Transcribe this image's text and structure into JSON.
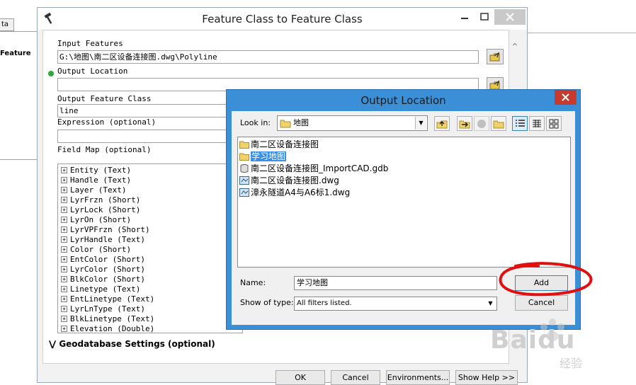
{
  "background": {
    "tab_text": "ta",
    "side_text": "Feature"
  },
  "main_dialog": {
    "title": "Feature Class to Feature Class",
    "input_features_label": "Input Features",
    "input_features_value": "G:\\地图\\南二区设备连接图.dwg\\Polyline",
    "output_location_label": "Output Location",
    "output_location_value": "",
    "output_feature_class_label": "Output Feature Class",
    "output_feature_class_value": "line",
    "expression_label": "Expression (optional)",
    "expression_value": "",
    "field_map_label": "Field Map (optional)",
    "fields": [
      "Entity (Text)",
      "Handle (Text)",
      "Layer (Text)",
      "LyrFrzn (Short)",
      "LyrLock (Short)",
      "LyrOn (Short)",
      "LyrVPFrzn (Short)",
      "LyrHandle (Text)",
      "Color (Short)",
      "EntColor (Short)",
      "LyrColor (Short)",
      "BlkColor (Short)",
      "Linetype (Text)",
      "EntLinetype (Text)",
      "LyrLnType (Text)",
      "BlkLinetype (Text)",
      "Elevation (Double)"
    ],
    "geodatabase_settings": "Geodatabase Settings (optional)",
    "buttons": {
      "ok": "OK",
      "cancel": "Cancel",
      "environments": "Environments...",
      "show_help": "Show Help >>"
    }
  },
  "output_dialog": {
    "title": "Output Location",
    "look_in_label": "Look in:",
    "look_in_value": "地图",
    "files": [
      {
        "name": "南二区设备连接图",
        "icon": "folder-icon",
        "selected": false
      },
      {
        "name": "学习地图",
        "icon": "folder-icon",
        "selected": true
      },
      {
        "name": "南二区设备连接图_ImportCAD.gdb",
        "icon": "geodatabase-icon",
        "selected": false
      },
      {
        "name": "南二区设备连接图.dwg",
        "icon": "cad-drawing-icon",
        "selected": false
      },
      {
        "name": "漳永隧道A4与A6标1.dwg",
        "icon": "cad-drawing-icon",
        "selected": false
      }
    ],
    "name_label": "Name:",
    "name_value": "学习地图",
    "show_type_label": "Show of type:",
    "show_type_value": "All filters listed.",
    "add_button": "Add",
    "cancel_button": "Cancel"
  },
  "watermark": {
    "text": "Baidu",
    "sub": "经验"
  },
  "colors": {
    "output_dialog_frame": "#3b8fd6",
    "close_button": "#c73a2e",
    "selection": "#3a8ee6",
    "annotation": "#e01010",
    "valid_dot": "#2ea836"
  }
}
